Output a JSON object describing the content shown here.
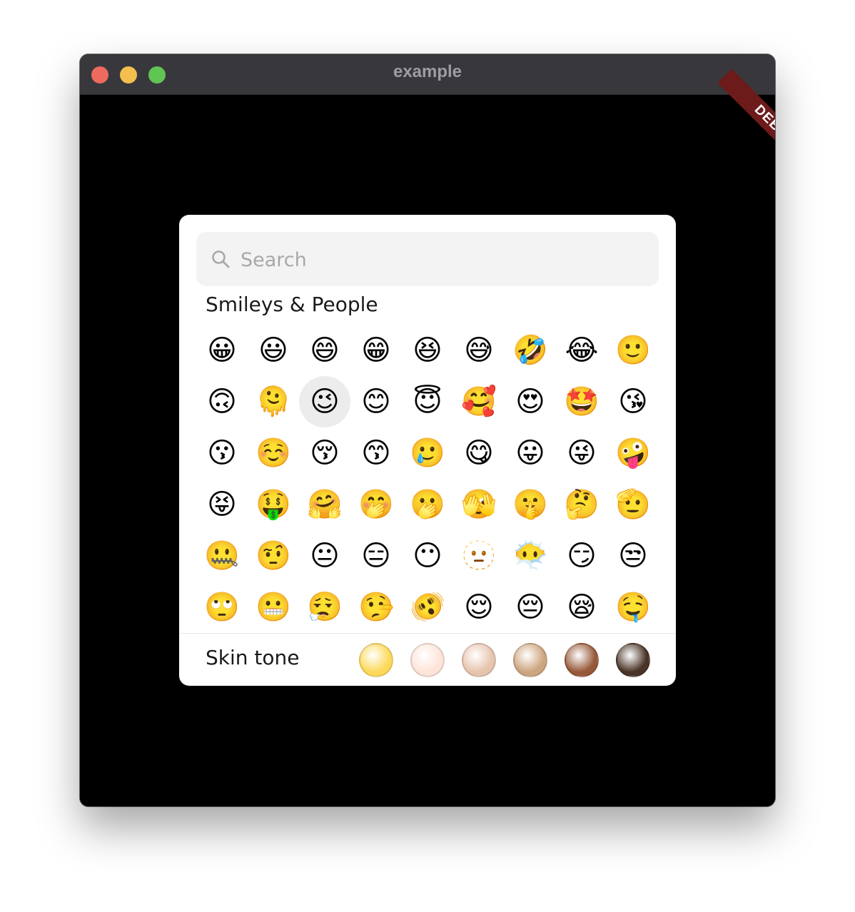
{
  "window": {
    "title": "example",
    "debug_banner": "DEBUG"
  },
  "picker": {
    "search": {
      "placeholder": "Search",
      "value": ""
    },
    "section_title": "Smileys & People",
    "selected_index": 11,
    "emojis": [
      "😀",
      "😃",
      "😄",
      "😁",
      "😆",
      "😅",
      "🤣",
      "😂",
      "🙂",
      "🙃",
      "🫠",
      "😉",
      "😊",
      "😇",
      "🥰",
      "😍",
      "🤩",
      "😘",
      "😗",
      "☺️",
      "😚",
      "😙",
      "🥲",
      "😋",
      "😛",
      "😜",
      "🤪",
      "😝",
      "🤑",
      "🤗",
      "🤭",
      "🫢",
      "🫣",
      "🤫",
      "🤔",
      "🫡",
      "🤐",
      "🤨",
      "😐",
      "😑",
      "😶",
      "🫥",
      "😶‍🌫️",
      "😏",
      "😒",
      "🙄",
      "😬",
      "😮‍💨",
      "🤥",
      "🫨",
      "😌",
      "😔",
      "😪",
      "🤤"
    ],
    "skin_tone_label": "Skin tone",
    "skin_tones": [
      {
        "name": "default",
        "color": "#fcd95a"
      },
      {
        "name": "light",
        "color": "#fde4d8"
      },
      {
        "name": "medium-light",
        "color": "#e7c4ae"
      },
      {
        "name": "medium",
        "color": "#cda580"
      },
      {
        "name": "medium-dark",
        "color": "#98593a"
      },
      {
        "name": "dark",
        "color": "#4a3427"
      }
    ]
  }
}
